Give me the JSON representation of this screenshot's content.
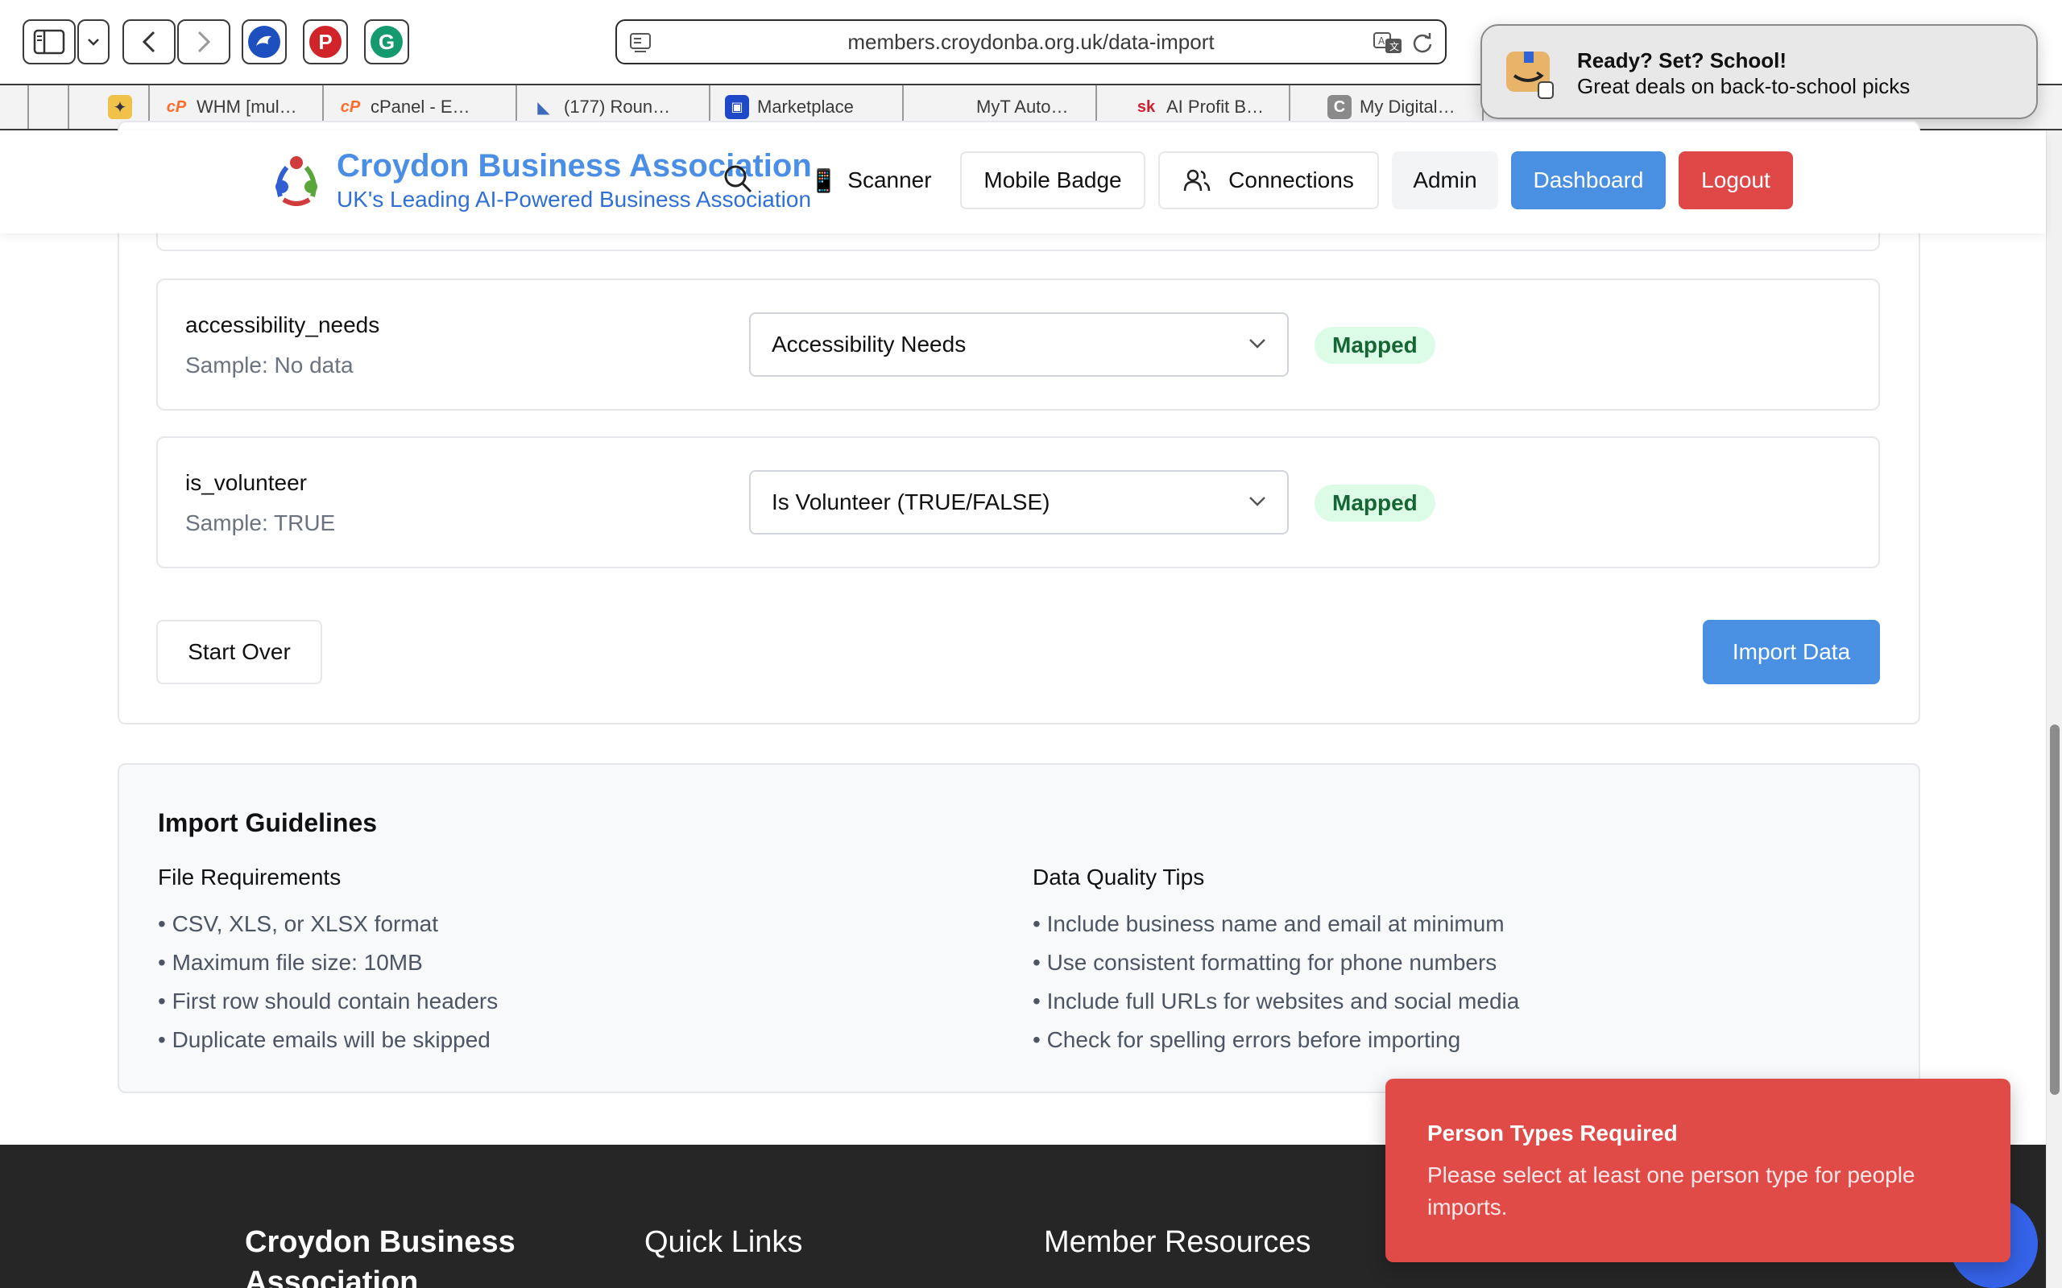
{
  "browser": {
    "url": "members.croydonba.org.uk/data-import",
    "bookmarks": [
      {
        "label": "",
        "icon": "blank"
      },
      {
        "label": "",
        "icon": "wizard-icon"
      },
      {
        "label": "WHM [mul…",
        "icon": "cpanel-icon"
      },
      {
        "label": "cPanel - E…",
        "icon": "cpanel-icon"
      },
      {
        "label": "(177) Roun…",
        "icon": "bird-icon"
      },
      {
        "label": "Marketplace",
        "icon": "bag-icon"
      },
      {
        "label": "MyT Auto…",
        "icon": "blank"
      },
      {
        "label": "AI Profit B…",
        "icon": "sk-icon"
      },
      {
        "label": "My Digital…",
        "icon": "c-icon"
      }
    ]
  },
  "notification": {
    "title": "Ready? Set? School!",
    "body": "Great deals on back-to-school picks"
  },
  "header": {
    "brand_name": "Croydon Business Association",
    "brand_tagline": "UK's Leading AI-Powered Business Association",
    "nav": {
      "scanner": "Scanner",
      "mobile_badge": "Mobile Badge",
      "connections": "Connections",
      "admin": "Admin",
      "dashboard": "Dashboard",
      "logout": "Logout"
    }
  },
  "mapping": {
    "rows": [
      {
        "field": "accessibility_needs",
        "sample": "Sample: No data",
        "selected": "Accessibility Needs",
        "status": "Mapped"
      },
      {
        "field": "is_volunteer",
        "sample": "Sample: TRUE",
        "selected": "Is Volunteer (TRUE/FALSE)",
        "status": "Mapped"
      }
    ],
    "start_over": "Start Over",
    "import_data": "Import Data"
  },
  "guidelines": {
    "title": "Import Guidelines",
    "file_requirements": {
      "title": "File Requirements",
      "items": [
        "• CSV, XLS, or XLSX format",
        "• Maximum file size: 10MB",
        "• First row should contain headers",
        "• Duplicate emails will be skipped"
      ]
    },
    "quality_tips": {
      "title": "Data Quality Tips",
      "items": [
        "• Include business name and email at minimum",
        "• Use consistent formatting for phone numbers",
        "• Include full URLs for websites and social media",
        "• Check for spelling errors before importing"
      ]
    }
  },
  "footer": {
    "brand": "Croydon Business Association",
    "quick_links": "Quick Links",
    "member_resources": "Member Resources"
  },
  "toast": {
    "title": "Person Types Required",
    "body": "Please select at least one person type for people imports."
  },
  "colors": {
    "primary": "#4a90e2",
    "danger": "#e04848",
    "success_bg": "#dcfce7",
    "success_text": "#166534",
    "footer_bg": "#262626"
  }
}
